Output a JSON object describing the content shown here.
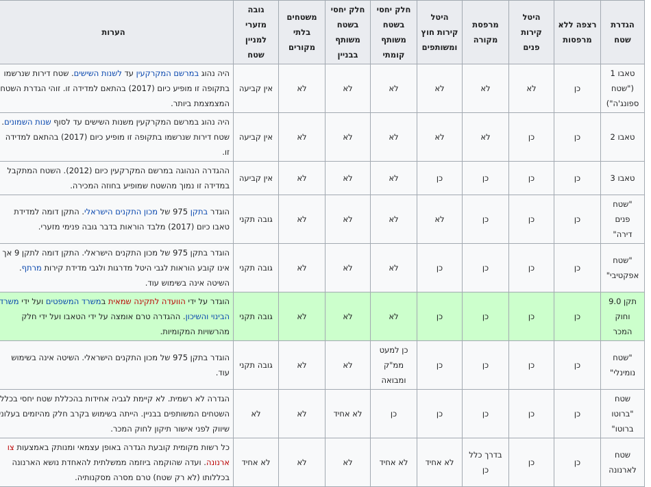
{
  "headers": [
    "הגדרת שטח",
    "רצפה ללא מרפסות",
    "היטל קירות פנים",
    "מרפסת מקורה",
    "היטל קירות חוץ ומשותפים",
    "חלק יחסי בשטח משותף קומתי",
    "חלק יחסי בשטח משותף בבניין",
    "משטחים בלתי מקורים",
    "גובה מזערי למניין שטח",
    "הערות"
  ],
  "rows": [
    {
      "cells": [
        "טאבו 1 (\"שטח ספונג'ה\")",
        "כן",
        "לא",
        "לא",
        "לא",
        "לא",
        "לא",
        "לא",
        "אין קביעה"
      ],
      "note": [
        {
          "t": "היה נהוג "
        },
        {
          "t": "במרשם המקרקעין",
          "link": true
        },
        {
          "t": " עד "
        },
        {
          "t": "לשנות השישים",
          "link": true
        },
        {
          "t": ". שטח דירות שנרשמו בתקופה זו מופיע כיום (2017) בהתאם למדידה זו. זוהי הגדרת השטח המצמצמת ביותר."
        }
      ]
    },
    {
      "cells": [
        "טאבו 2",
        "כן",
        "כן",
        "לא",
        "לא",
        "לא",
        "לא",
        "לא",
        "אין קביעה"
      ],
      "note": [
        {
          "t": "היה נהוג במרשם המקרקעין משנות השישים עד לסוף "
        },
        {
          "t": "שנות השמונים",
          "link": true
        },
        {
          "t": ". שטח דירות שנרשמו בתקופה זו מופיע כיום (2017) בהתאם למדידה זו."
        }
      ]
    },
    {
      "cells": [
        "טאבו 3",
        "כן",
        "כן",
        "כן",
        "כן",
        "לא",
        "לא",
        "לא",
        "אין קביעה"
      ],
      "note": [
        {
          "t": "ההגדרה הנהוגה במרשם המקרקעין כיום (2012). השטח המתקבל במדידה זו נמוך מהשטח שמופיע בחוזה המכירה."
        }
      ]
    },
    {
      "cells": [
        "\"שטח פנים דירה\"",
        "כן",
        "כן",
        "כן",
        "לא",
        "לא",
        "לא",
        "לא",
        "גובה תקני"
      ],
      "note": [
        {
          "t": "הוגדר "
        },
        {
          "t": "בתקן",
          "link": true
        },
        {
          "t": " 975 של "
        },
        {
          "t": "מכון התקנים הישראלי",
          "link": true
        },
        {
          "t": ". התקן דומה למדידת טאבו כיום (2017) מלבד הוראות בדבר גובה פנימי מזערי."
        }
      ]
    },
    {
      "cells": [
        "\"שטח אפקטיבי\"",
        "כן",
        "כן",
        "כן",
        "כן",
        "לא",
        "לא",
        "לא",
        "גובה תקני"
      ],
      "note": [
        {
          "t": "הוגדר בתקן 975 של מכון התקנים הישראלי. התקן דומה לתקן 9 אך אינו קובע הוראות לגבי היטל מדרגות ולגבי מדידת קירות "
        },
        {
          "t": "מרתף",
          "link": true
        },
        {
          "t": ". השיטה אינה בשימוש עוד."
        }
      ]
    },
    {
      "highlight": true,
      "cells": [
        "תקן 9.0 וחוק המכר",
        "כן",
        "כן",
        "כן",
        "כן",
        "לא",
        "לא",
        "לא",
        "גובה תקני"
      ],
      "note": [
        {
          "t": "הוגדר על ידי "
        },
        {
          "t": "הוועדה לתקינה שמאית",
          "link": true,
          "red": true
        },
        {
          "t": " ב"
        },
        {
          "t": "משרד המשפטים",
          "link": true
        },
        {
          "t": " ועל ידי "
        },
        {
          "t": "משרד הבינוי והשיכון",
          "link": true
        },
        {
          "t": ". ההגדרה טרם אומצה על ידי הטאבו ועל ידי חלק מהרשויות המקומיות."
        }
      ]
    },
    {
      "cells": [
        "\"שטח נומינלי\"",
        "כן",
        "כן",
        "כן",
        "כן",
        "כן למעט ממ\"ק ומבואה",
        "לא",
        "לא",
        "גובה תקני"
      ],
      "note": [
        {
          "t": "הוגדר בתקן 975 של מכון התקנים הישראלי. השיטה אינה בשימוש עוד."
        }
      ]
    },
    {
      "cells": [
        "שטח \"ברוטו ברוטו\"",
        "כן",
        "כן",
        "כן",
        "כן",
        "כן",
        "לא אחיד",
        "לא",
        "לא"
      ],
      "note": [
        {
          "t": "הגדרה לא רשמית. לא קיימת לגביה אחידות בהכללת שטח יחסי בכלל השטחים המשותפים בבניין. הייתה בשימוש בקרב חלק מהיזמים בעלוני שיווק לפני אישור תיקון לחוק המכר."
        }
      ]
    },
    {
      "cells": [
        "שטח לארנונה",
        "כן",
        "כן",
        "בדרך כלל כן",
        "לא אחיד",
        "לא אחיד",
        "לא",
        "לא",
        "לא אחיד"
      ],
      "note": [
        {
          "t": "כל רשות מקומית קובעת הגדרה באופן עצמאי ומנותק באמצעות "
        },
        {
          "t": "צו ארנונה",
          "link": true,
          "red": true
        },
        {
          "t": ". ועדה שהוקמה ביוזמה ממשלתית להאחדת נושא הארנונה בכללותו (לא רק שטח) טרם מסרה מסקנותיה."
        }
      ]
    }
  ]
}
